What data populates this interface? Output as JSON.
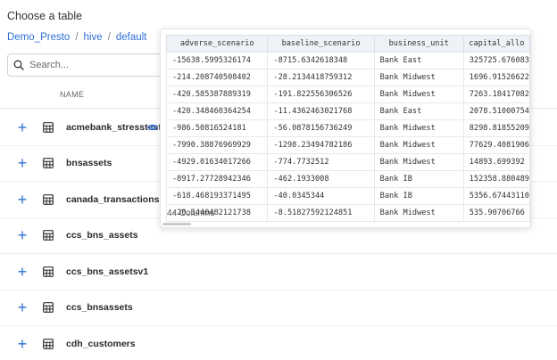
{
  "page_title": "Choose a table",
  "breadcrumb": {
    "items": [
      "Demo_Presto",
      "hive",
      "default"
    ],
    "separator": "/"
  },
  "search": {
    "placeholder": "Search...",
    "value": ""
  },
  "list": {
    "column_header": "NAME",
    "tables": [
      {
        "name": "acmebank_stresstest",
        "preview_visible": true
      },
      {
        "name": "bnsassets"
      },
      {
        "name": "canada_transactions"
      },
      {
        "name": "ccs_bns_assets"
      },
      {
        "name": "ccs_bns_assetsv1"
      },
      {
        "name": "ccs_bnsassets"
      },
      {
        "name": "cdh_customers"
      }
    ]
  },
  "preview": {
    "columns": [
      "adverse_scenario",
      "baseline_scenario",
      "business_unit",
      "capital_allo"
    ],
    "rows": [
      [
        "-15638.5995326174",
        "-8715.6342618348",
        "Bank East",
        "325725.676083"
      ],
      [
        "-214.208740508402",
        "-28.2134418759312",
        "Bank Midwest",
        "1696.91526622"
      ],
      [
        "-420.585387889319",
        "-191.822556306526",
        "Bank Midwest",
        "7263.18417082"
      ],
      [
        "-420.348460364254",
        "-11.4362463021768",
        "Bank East",
        "2078.51000754"
      ],
      [
        "-986.50816524181",
        "-56.0878156736249",
        "Bank Midwest",
        "8298.81855209"
      ],
      [
        "-7990.38876969929",
        "-1298.23494782186",
        "Bank Midwest",
        "77629.4081906"
      ],
      [
        "-4929.01634017266",
        "-774.7732512",
        "Bank Midwest",
        "14893.699392"
      ],
      [
        "-8917.27728942346",
        "-462.1933008",
        "Bank IB",
        "152358.880489"
      ],
      [
        "-618.468193371495",
        "-40.0345344",
        "Bank IB",
        "5356.67443110"
      ],
      [
        "-20.3440482121738",
        "-8.51827592124851",
        "Bank Midwest",
        "535.90706766"
      ]
    ],
    "footer": "44 Columns"
  },
  "colors": {
    "accent": "#2f6fd6",
    "header_bg": "#eef2f7",
    "border": "#e1e4e8"
  }
}
